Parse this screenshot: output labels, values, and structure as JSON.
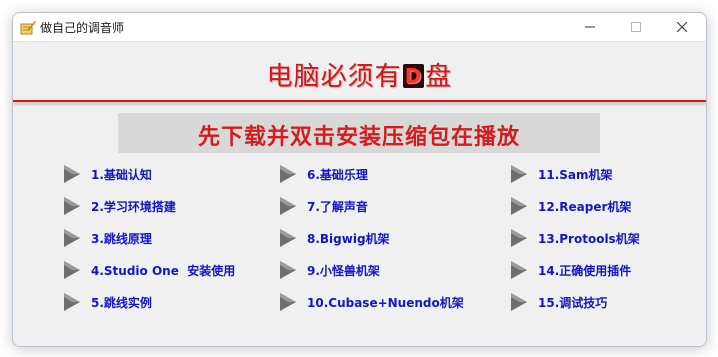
{
  "window": {
    "title": "做自己的调音师"
  },
  "banner": {
    "prefix": "电脑必须有",
    "mark": "D",
    "suffix": "盘"
  },
  "notice": {
    "text": "先下载并双击安装压缩包在播放"
  },
  "menu": {
    "col1": [
      {
        "label": "1.基础认知"
      },
      {
        "label": "2.学习环境搭建"
      },
      {
        "label": "3.跳线原理"
      },
      {
        "label": "4.Studio One  安装使用"
      },
      {
        "label": "5.跳线实例"
      }
    ],
    "col2": [
      {
        "label": "6.基础乐理"
      },
      {
        "label": "7.了解声音"
      },
      {
        "label": "8.Bigwig机架"
      },
      {
        "label": "9.小怪兽机架"
      },
      {
        "label": "10.Cubase+Nuendo机架"
      }
    ],
    "col3": [
      {
        "label": "11.Sam机架"
      },
      {
        "label": "12.Reaper机架"
      },
      {
        "label": "13.Protools机架"
      },
      {
        "label": "14.正确使用插件"
      },
      {
        "label": "15.调试技巧"
      }
    ]
  },
  "icons": {
    "app": "pencil-notebook-icon",
    "item": "play-arrow-icon",
    "minimize": "minimize-icon",
    "maximize": "maximize-icon",
    "close": "close-icon"
  },
  "colors": {
    "banner_red": "#cc1a1a",
    "notice_red": "#d41c1c",
    "link_blue": "#1414c8",
    "arrow_gray": "#6e6e6e"
  }
}
